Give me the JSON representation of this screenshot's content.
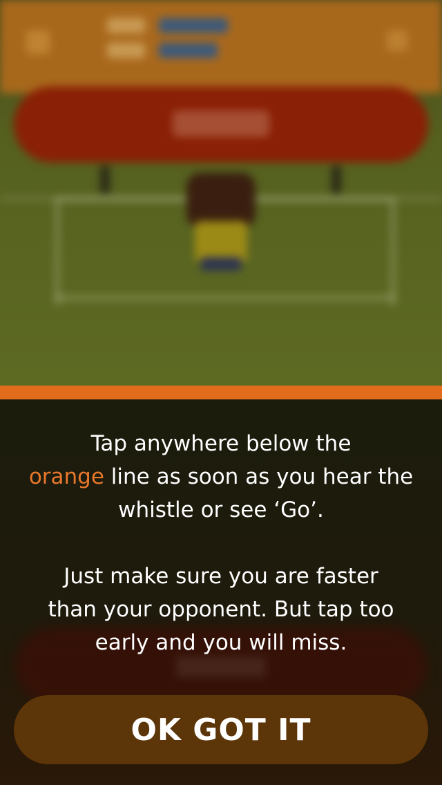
{
  "tutorial": {
    "line1": "Tap anywhere below the",
    "highlight_word": "orange",
    "line2_rest": " line as soon as you hear the",
    "line3": "whistle or see ‘Go’.",
    "line4": "Just make sure you are faster",
    "line5": "than your opponent. But tap too",
    "line6": "early and you will miss."
  },
  "confirm_button": {
    "label": "OK GOT IT"
  },
  "colors": {
    "accent": "#e06c1c",
    "button_bg": "#5c3508",
    "topbar": "#a8681c",
    "field": "#5d6a22"
  }
}
